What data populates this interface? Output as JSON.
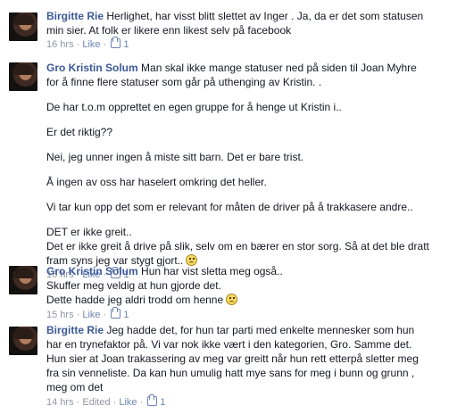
{
  "comments": [
    {
      "author": "Birgitte Rie",
      "lines": [
        "Herlighet, har visst blitt slettet av Inger . Ja, da er det som statusen",
        "min sier. At folk er likere enn likest selv på facebook"
      ],
      "time": "16 hrs",
      "edited": "",
      "like_label": "Like",
      "like_count": "1"
    },
    {
      "author": "Gro Kristin Solum",
      "paragraphs": [
        [
          "Man skal ikke mange statuser ned på siden til Joan Myhre",
          "for å finne flere statuser som går på uthenging av Kristin. ."
        ],
        [
          "De har t.o.m opprettet en egen gruppe for å henge ut Kristin i.."
        ],
        [
          "Er det riktig??"
        ],
        [
          "Nei, jeg unner ingen å miste sitt barn. Det er bare trist."
        ],
        [
          "Å ingen av oss har haselert omkring det heller."
        ],
        [
          "Vi tar kun opp det som er relevant for måten de driver på å trakkasere andre.."
        ],
        [
          "DET er ikke greit..",
          "Det er ikke greit å drive på slik, selv om en bærer en stor sorg. Så at det ble dratt",
          "fram syns jeg var stygt gjort.."
        ]
      ],
      "time": "16 hrs",
      "edited": "",
      "like_label": "Like",
      "like_count": "1"
    },
    {
      "author": "Gro Kristin Solum",
      "lines": [
        "Hun har vist sletta meg også..",
        "Skuffer meg veldig at hun gjorde det.",
        "Dette hadde jeg aldri trodd om henne"
      ],
      "time": "15 hrs",
      "edited": "",
      "like_label": "Like",
      "like_count": "1"
    },
    {
      "author": "Birgitte Rie",
      "lines": [
        "Jeg hadde det, for hun tar parti med enkelte mennesker som hun",
        "har en trynefaktor på. Vi var nok ikke vært i den kategorien, Gro. Samme det.",
        "Hun sier at Joan trakassering av meg var greitt når hun rett etterpå sletter meg",
        "fra sin venneliste. Da kan hun umulig hatt mye sans for meg i bunn og grunn ,",
        "meg om det"
      ],
      "time": "14 hrs",
      "edited": "Edited",
      "like_label": "Like",
      "like_count": "1"
    }
  ],
  "separator": "·",
  "icons": {
    "like": "thumbs-up-icon",
    "emoticon": "frown-emoticon-icon"
  }
}
